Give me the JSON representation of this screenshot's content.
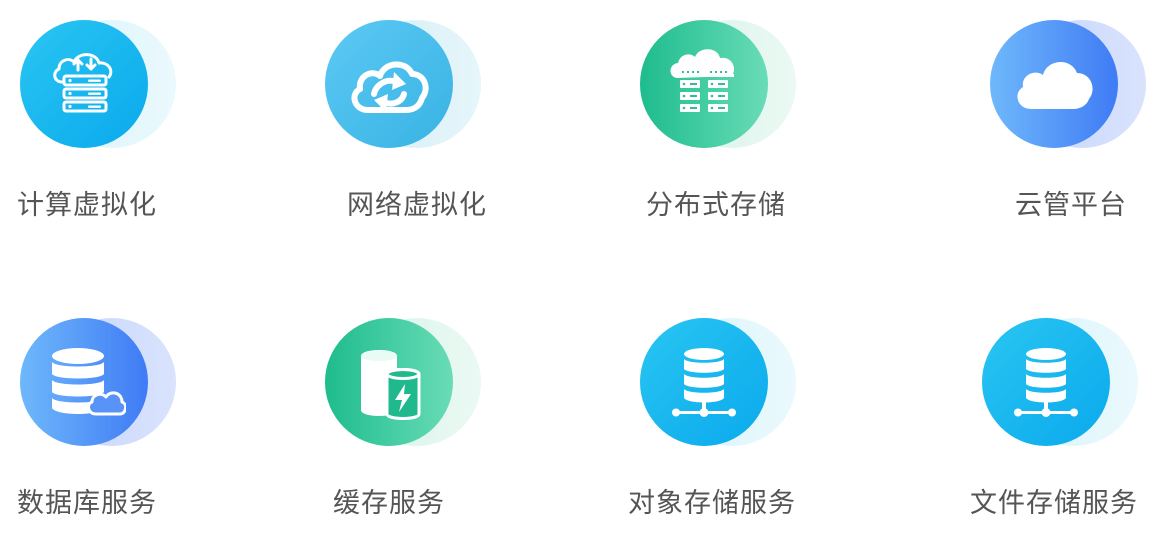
{
  "services": [
    {
      "label": "计算虚拟化",
      "icon": "server-cloud-icon",
      "theme": "cyan"
    },
    {
      "label": "网络虚拟化",
      "icon": "cloud-sync-icon",
      "theme": "sky"
    },
    {
      "label": "分布式存储",
      "icon": "cloud-storage-rack-icon",
      "theme": "green"
    },
    {
      "label": "云管平台",
      "icon": "cloud-icon",
      "theme": "blue"
    },
    {
      "label": "数据库服务",
      "icon": "database-cloud-icon",
      "theme": "blue"
    },
    {
      "label": "缓存服务",
      "icon": "cache-battery-icon",
      "theme": "green"
    },
    {
      "label": "对象存储服务",
      "icon": "database-network-icon",
      "theme": "cyan"
    },
    {
      "label": "文件存储服务",
      "icon": "database-network-icon",
      "theme": "cyan"
    }
  ]
}
